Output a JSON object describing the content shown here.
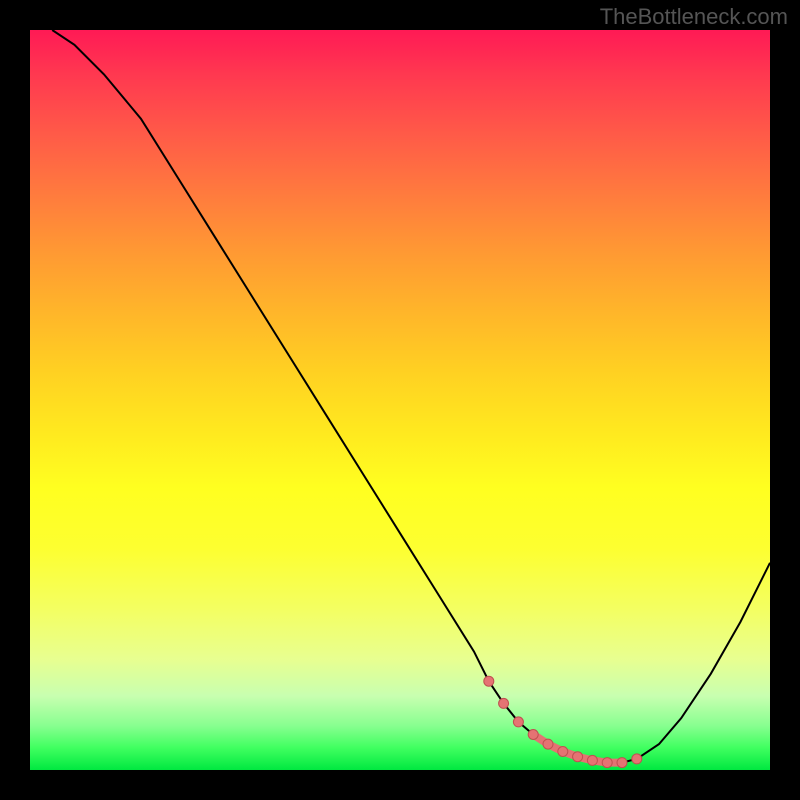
{
  "watermark": "TheBottleneck.com",
  "colors": {
    "background": "#000000",
    "curve": "#000000",
    "marker": "#e57373",
    "gradient_top": "#ff1a55",
    "gradient_bottom": "#00e840"
  },
  "chart_data": {
    "type": "line",
    "title": "",
    "xlabel": "",
    "ylabel": "",
    "xlim": [
      0,
      100
    ],
    "ylim": [
      0,
      100
    ],
    "x": [
      3,
      6,
      10,
      15,
      20,
      25,
      30,
      35,
      40,
      45,
      50,
      55,
      60,
      62,
      64,
      66,
      68,
      70,
      72,
      74,
      76,
      78,
      80,
      82,
      85,
      88,
      92,
      96,
      100
    ],
    "values": [
      100,
      98,
      94,
      88,
      80,
      72,
      64,
      56,
      48,
      40,
      32,
      24,
      16,
      12,
      9,
      6.5,
      4.8,
      3.5,
      2.5,
      1.8,
      1.3,
      1.0,
      1.0,
      1.5,
      3.5,
      7,
      13,
      20,
      28
    ],
    "markers": {
      "x": [
        62,
        64,
        66,
        68,
        70,
        72,
        74,
        76,
        78,
        80,
        82
      ],
      "values": [
        12,
        9,
        6.5,
        4.8,
        3.5,
        2.5,
        1.8,
        1.3,
        1.0,
        1.0,
        1.5
      ]
    }
  }
}
